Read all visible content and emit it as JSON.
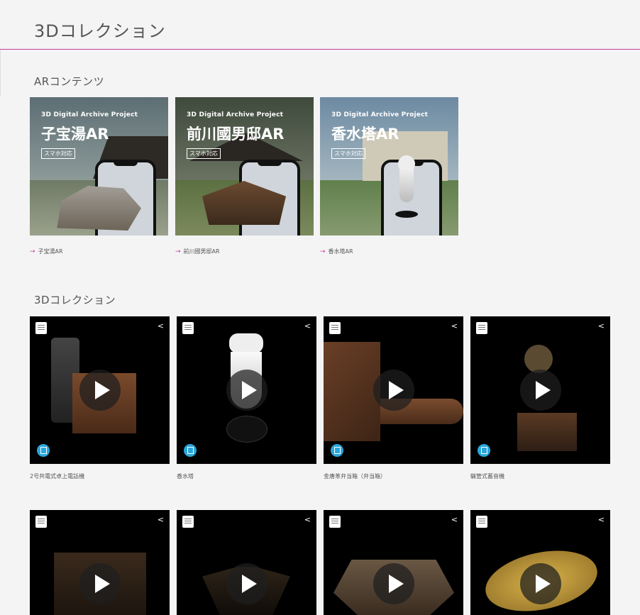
{
  "page": {
    "title": "3Dコレクション"
  },
  "ar_section": {
    "heading": "ARコンテンツ",
    "cards": [
      {
        "project": "3D Digital Archive Project",
        "name": "子宝湯AR",
        "badge": "スマホ対応",
        "link": "子宝湯AR"
      },
      {
        "project": "3D Digital Archive Project",
        "name": "前川國男邸AR",
        "badge": "スマホ対応",
        "link": "前川國男邸AR"
      },
      {
        "project": "3D Digital Archive Project",
        "name": "香水塔AR",
        "badge": "スマホ対応",
        "link": "香水塔AR"
      }
    ]
  },
  "collection_section": {
    "heading": "3Dコレクション",
    "items": [
      {
        "caption": "2号共電式卓上電話機"
      },
      {
        "caption": "香水塔"
      },
      {
        "caption": "金唐革弁当箱（弁当箱）"
      },
      {
        "caption": "蝋管式蓄音機"
      },
      {
        "caption": ""
      },
      {
        "caption": ""
      },
      {
        "caption": ""
      },
      {
        "caption": ""
      }
    ]
  },
  "icons": {
    "share": "share-icon",
    "play": "play-icon",
    "viewer": "3d-viewer-icon",
    "logo": "tokyo-museum-collection-logo",
    "arrow": "arrow-right-icon"
  },
  "colors": {
    "accent": "#c43c9a",
    "viewer_badge": "#2aa6dc",
    "tile_bg": "#000000"
  }
}
